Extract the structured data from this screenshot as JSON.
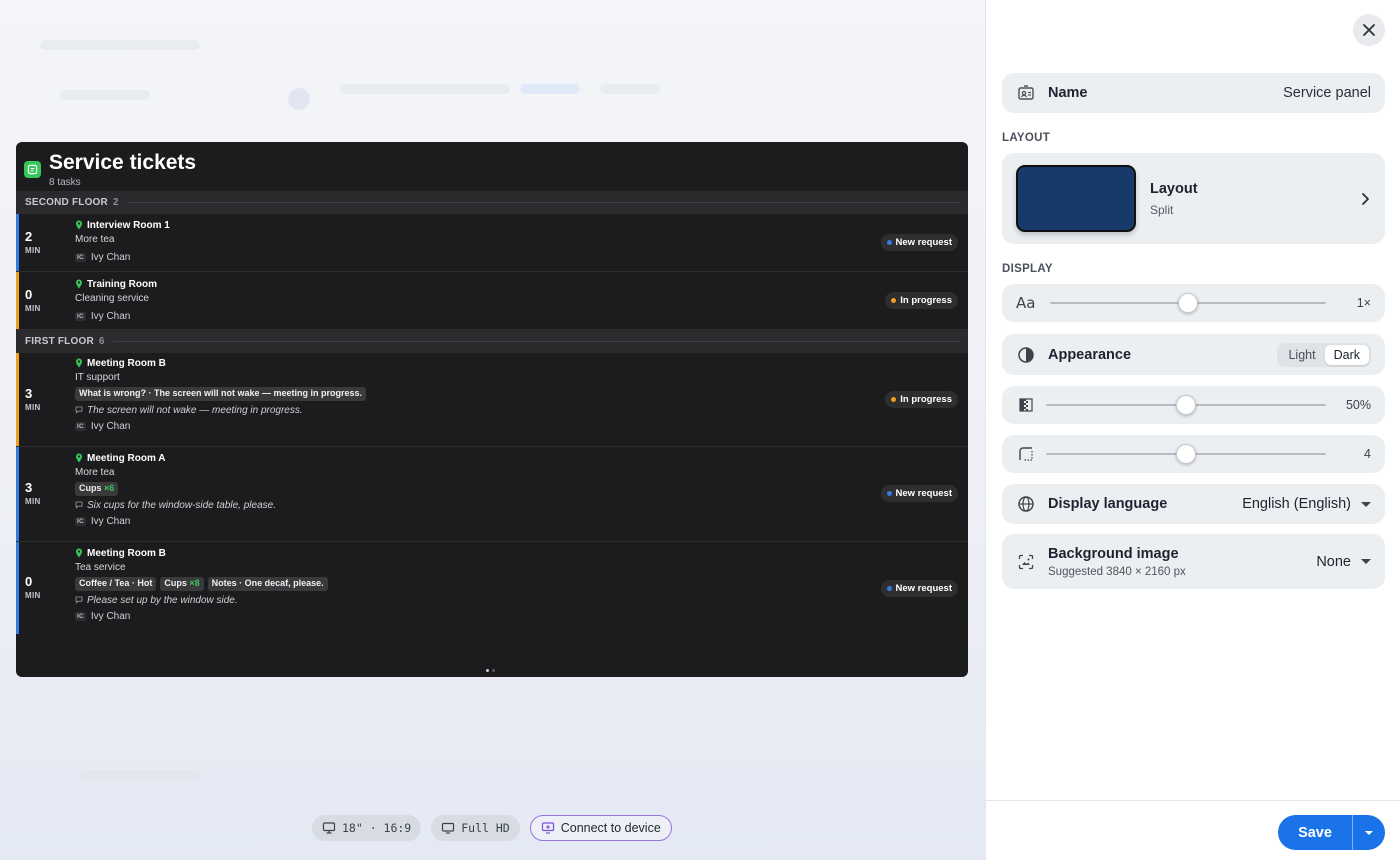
{
  "preview": {
    "title": "Service tickets",
    "subtitle": "8 tasks",
    "floors": [
      {
        "name": "SECOND FLOOR",
        "count": "2"
      },
      {
        "name": "FIRST FLOOR",
        "count": "6"
      }
    ],
    "unit": "MIN",
    "tickets": [
      {
        "minutes": "2",
        "location": "Interview Room 1",
        "service": "More tea",
        "person": "Ivy Chan",
        "initials": "IC",
        "status": "New request",
        "accent": "#2f7de1",
        "dot": "#2f7de1"
      },
      {
        "minutes": "0",
        "location": "Training Room",
        "service": "Cleaning service",
        "person": "Ivy Chan",
        "initials": "IC",
        "status": "In progress",
        "accent": "#f0a020",
        "dot": "#f0a020"
      },
      {
        "minutes": "3",
        "location": "Meeting Room B",
        "service": "IT support",
        "chip": "What is wrong? · The screen will not wake — meeting in progress.",
        "note": "The screen will not wake — meeting in progress.",
        "person": "Ivy Chan",
        "initials": "IC",
        "status": "In progress",
        "accent": "#f0a020",
        "dot": "#f0a020"
      },
      {
        "minutes": "3",
        "location": "Meeting Room A",
        "service": "More tea",
        "chip_text": "Cups",
        "chip_qty": "×6",
        "note": "Six cups for the window-side table, please.",
        "person": "Ivy Chan",
        "initials": "IC",
        "status": "New request",
        "accent": "#2f7de1",
        "dot": "#2f7de1"
      },
      {
        "minutes": "0",
        "location": "Meeting Room B",
        "service": "Tea service",
        "chip1": "Coffee / Tea · Hot",
        "chip2_text": "Cups",
        "chip2_qty": "×8",
        "chip3": "Notes · One decaf, please.",
        "note": "Please set up by the window side.",
        "person": "Ivy Chan",
        "initials": "IC",
        "status": "New request",
        "accent": "#2f7de1",
        "dot": "#2f7de1"
      }
    ]
  },
  "bottom_bar": {
    "size": "18\" · 16:9",
    "resolution": "Full HD",
    "connect": "Connect to device"
  },
  "panel": {
    "name_label": "Name",
    "name_value": "Service panel",
    "layout_section": "LAYOUT",
    "layout_title": "Layout",
    "layout_value": "Split",
    "layout_color": "#173a6b",
    "display_section": "DISPLAY",
    "font_glyph": "Aa",
    "font_scale": "1×",
    "font_scale_fraction": 0.5,
    "appearance_label": "Appearance",
    "appearance_options": [
      "Light",
      "Dark"
    ],
    "appearance_selected": "Dark",
    "dim_value": "50%",
    "dim_fraction": 0.5,
    "radius_value": "4",
    "radius_fraction": 0.5,
    "language_label": "Display language",
    "language_value": "English (English)",
    "bg_label": "Background image",
    "bg_hint": "Suggested 3840 × 2160 px",
    "bg_value": "None",
    "save_label": "Save"
  },
  "colors": {
    "primary": "#1a73e8",
    "success": "#34c759",
    "connect_border": "#9a72e6"
  }
}
